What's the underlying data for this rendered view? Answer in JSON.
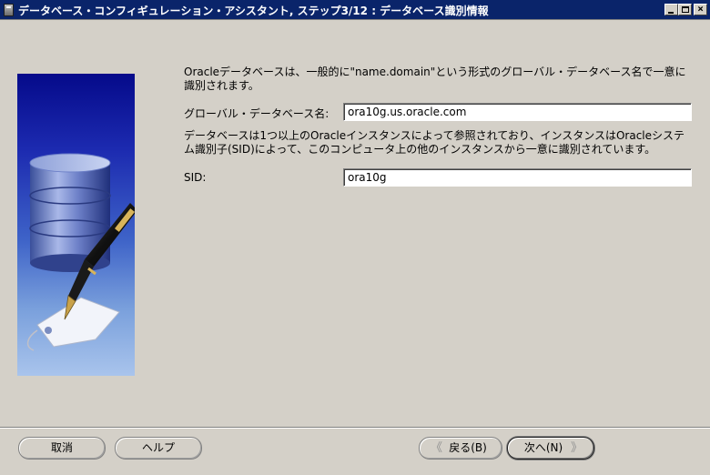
{
  "window": {
    "title": "データベース・コンフィギュレーション・アシスタント, ステップ3/12 : データベース識別情報",
    "min_glyph": "",
    "max_glyph": "",
    "close_glyph": "×"
  },
  "form": {
    "intro": "Oracleデータベースは、一般的に\"name.domain\"という形式のグローバル・データベース名で一意に識別されます。",
    "global_db_label": "グローバル・データベース名:",
    "global_db_value": "ora10g.us.oracle.com",
    "sid_description": "データベースは1つ以上のOracleインスタンスによって参照されており、インスタンスはOracleシステム識別子(SID)によって、このコンピュータ上の他のインスタンスから一意に識別されています。",
    "sid_label": "SID:",
    "sid_value": "ora10g"
  },
  "buttons": {
    "cancel": "取消",
    "help": "ヘルプ",
    "back": "戻る(B)",
    "next": "次へ(N)",
    "back_chevron": "《",
    "next_chevron": "》"
  },
  "colors": {
    "titlebar": "#0a246a",
    "dialog_bg": "#d4d0c8",
    "illustration_top": "#050a8a",
    "illustration_bottom": "#a9c4ec"
  }
}
